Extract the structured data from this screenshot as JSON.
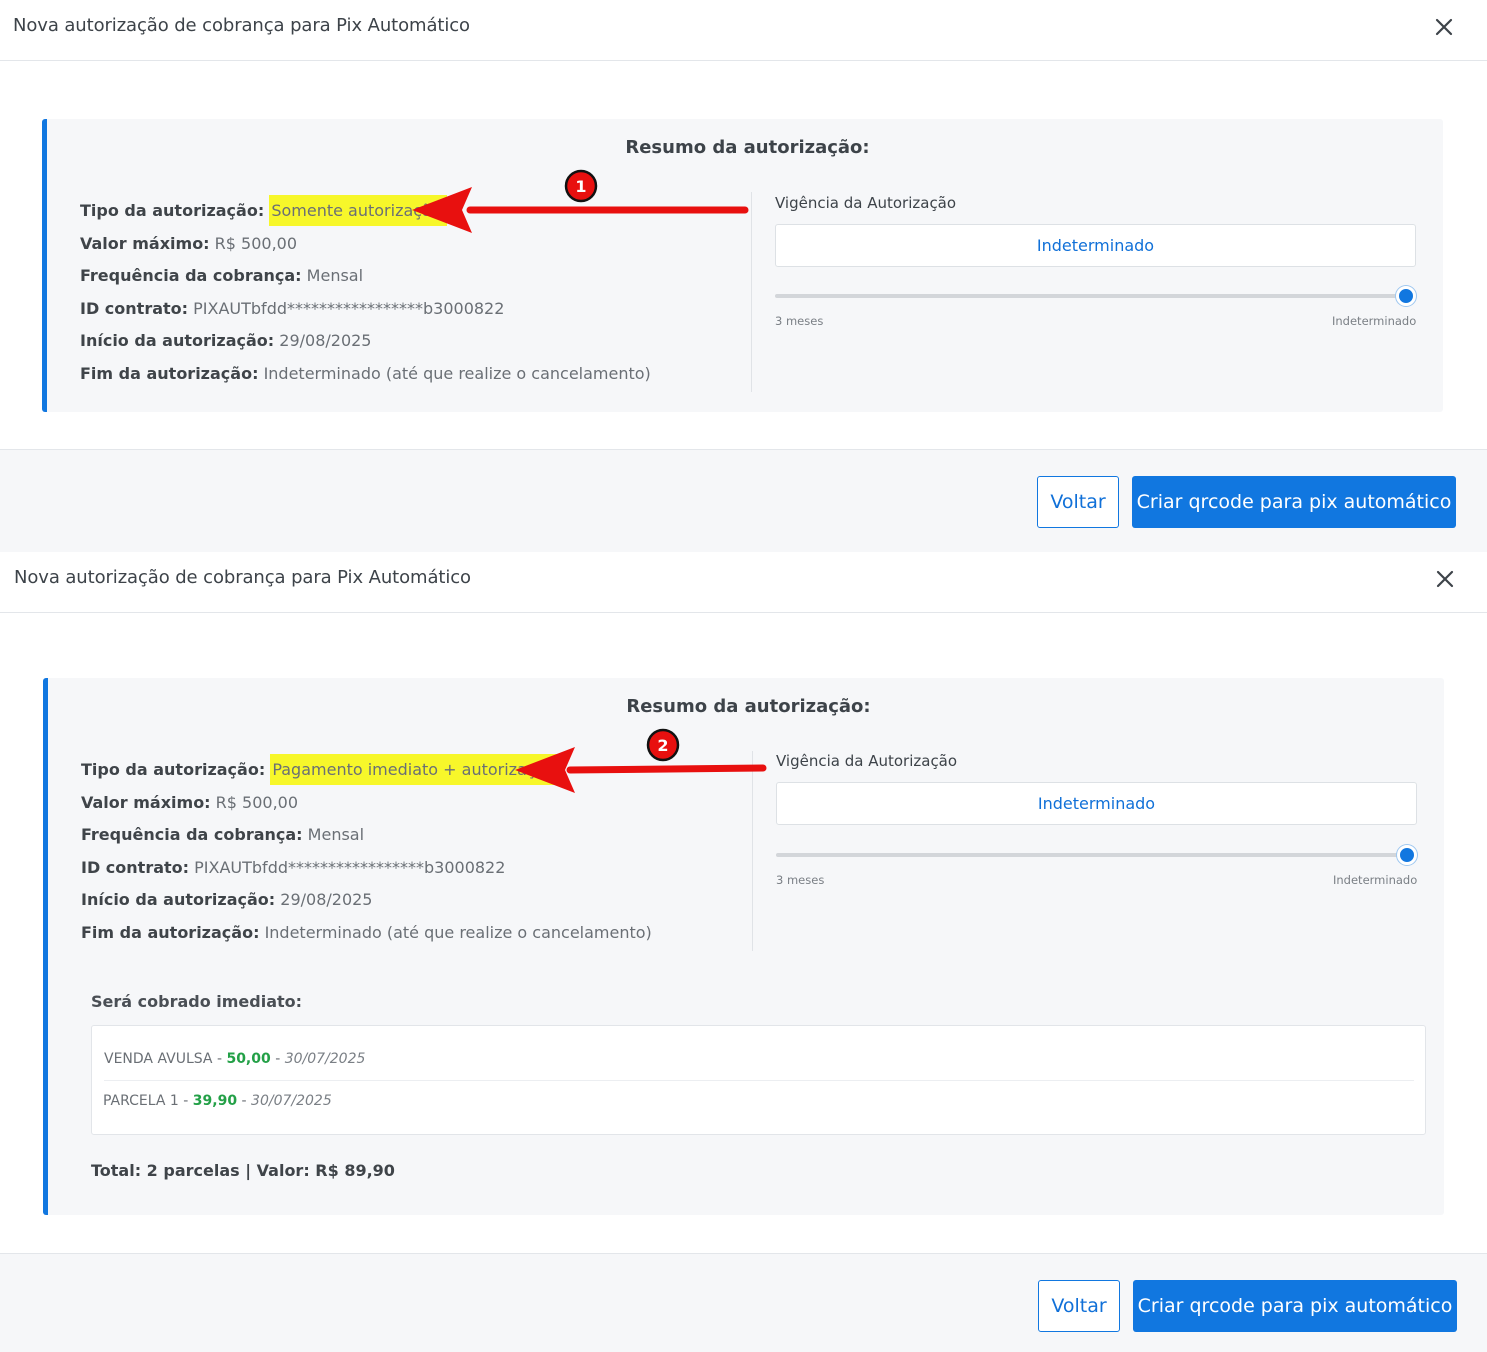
{
  "modal1": {
    "title": "Nova autorização de cobrança para Pix Automático",
    "summary_title": "Resumo da autorização:",
    "fields": [
      {
        "label": "Tipo da autorização:",
        "value": "Somente autorização"
      },
      {
        "label": "Valor máximo:",
        "value": "R$ 500,00"
      },
      {
        "label": "Frequência da cobrança:",
        "value": "Mensal"
      },
      {
        "label": "ID contrato:",
        "value": "PIXAUTbfdd*****************b3000822"
      },
      {
        "label": "Início da autorização:",
        "value": "29/08/2025"
      },
      {
        "label": "Fim da autorização:",
        "value": "Indeterminado (até que realize o cancelamento)"
      }
    ],
    "vigencia_label": "Vigência da Autorização",
    "vigencia_value": "Indeterminado",
    "slider": {
      "min_label": "3 meses",
      "max_label": "Indeterminado",
      "position": 1.0
    },
    "annotation_number": "1",
    "buttons": {
      "back": "Voltar",
      "create": "Criar qrcode para pix automático"
    }
  },
  "modal2": {
    "title": "Nova autorização de cobrança para Pix Automático",
    "summary_title": "Resumo da autorização:",
    "fields": [
      {
        "label": "Tipo da autorização:",
        "value": "Pagamento imediato + autorização"
      },
      {
        "label": "Valor máximo:",
        "value": "R$ 500,00"
      },
      {
        "label": "Frequência da cobrança:",
        "value": "Mensal"
      },
      {
        "label": "ID contrato:",
        "value": "PIXAUTbfdd*****************b3000822"
      },
      {
        "label": "Início da autorização:",
        "value": "29/08/2025"
      },
      {
        "label": "Fim da autorização:",
        "value": "Indeterminado (até que realize o cancelamento)"
      }
    ],
    "vigencia_label": "Vigência da Autorização",
    "vigencia_value": "Indeterminado",
    "slider": {
      "min_label": "3 meses",
      "max_label": "Indeterminado",
      "position": 1.0
    },
    "annotation_number": "2",
    "immediate": {
      "title": "Será cobrado imediato:",
      "items": [
        {
          "name": "VENDA AVULSA",
          "sep1": " - ",
          "value": "50,00",
          "sep2": " - ",
          "date": "30/07/2025"
        },
        {
          "name": "PARCELA 1",
          "sep1": " - ",
          "value": "39,90",
          "sep2": " - ",
          "date": "30/07/2025"
        }
      ],
      "total": "Total: 2 parcelas | Valor: R$ 89,90"
    },
    "buttons": {
      "back": "Voltar",
      "create": "Criar qrcode para pix automático"
    }
  },
  "colors": {
    "accent": "#1177e0",
    "highlight": "#f7f72a",
    "annotation_red": "#e8100f",
    "value_green": "#23a047"
  },
  "icons": {
    "close": "close-icon",
    "annotation_arrow": "red-arrow"
  }
}
